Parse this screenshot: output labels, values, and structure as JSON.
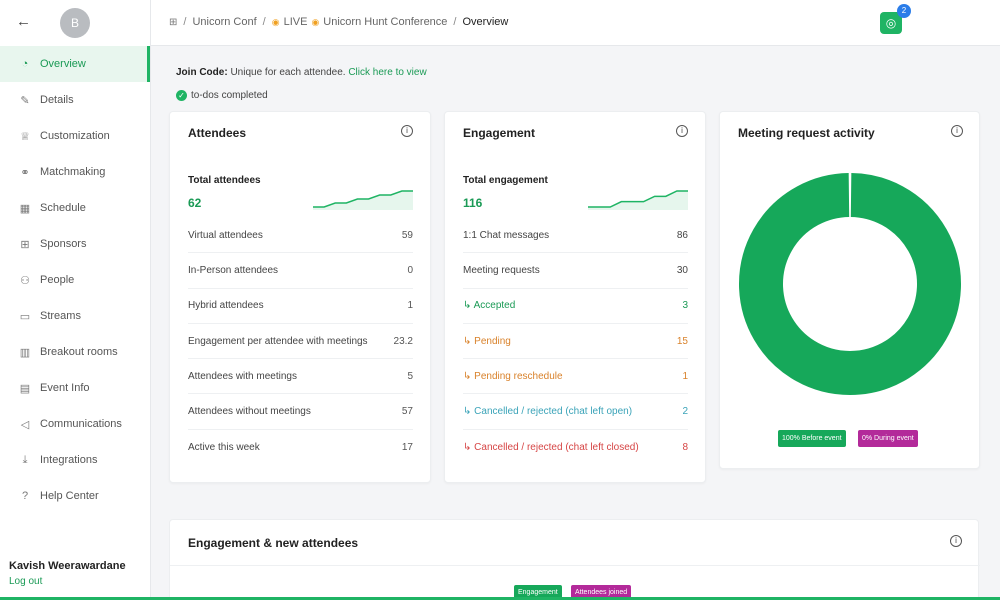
{
  "sidebar": {
    "avatar_letter": "B",
    "items": [
      {
        "label": "Overview",
        "icon": "overview-icon",
        "active": true
      },
      {
        "label": "Details",
        "icon": "edit-icon"
      },
      {
        "label": "Customization",
        "icon": "brush-icon"
      },
      {
        "label": "Matchmaking",
        "icon": "link-icon"
      },
      {
        "label": "Schedule",
        "icon": "calendar-icon"
      },
      {
        "label": "Sponsors",
        "icon": "grid-icon"
      },
      {
        "label": "People",
        "icon": "people-icon"
      },
      {
        "label": "Streams",
        "icon": "monitor-icon"
      },
      {
        "label": "Breakout rooms",
        "icon": "door-icon"
      },
      {
        "label": "Event Info",
        "icon": "document-icon"
      },
      {
        "label": "Communications",
        "icon": "megaphone-icon"
      },
      {
        "label": "Integrations",
        "icon": "download-icon"
      },
      {
        "label": "Help Center",
        "icon": "help-icon"
      }
    ],
    "user_name": "Kavish Weerawardane",
    "logout_label": "Log out"
  },
  "header": {
    "breadcrumb": [
      "Unicorn Conf",
      "LIVE",
      "Unicorn Hunt Conference",
      "Overview"
    ],
    "notification_count": "2"
  },
  "join": {
    "label": "Join Code:",
    "text": "Unique for each attendee.",
    "link": "Click here to view"
  },
  "todo": "to-dos completed",
  "attendees": {
    "title": "Attendees",
    "total_label": "Total attendees",
    "total_value": "62",
    "sparkline": [
      1,
      1,
      1.5,
      1.5,
      2,
      2,
      2.5,
      2.5,
      3,
      3
    ],
    "rows": [
      {
        "label": "Virtual attendees",
        "value": "59"
      },
      {
        "label": "In-Person attendees",
        "value": "0"
      },
      {
        "label": "Hybrid attendees",
        "value": "1"
      },
      {
        "label": "Engagement per attendee with meetings",
        "value": "23.2"
      },
      {
        "label": "Attendees with meetings",
        "value": "5"
      },
      {
        "label": "Attendees without meetings",
        "value": "57"
      },
      {
        "label": "Active this week",
        "value": "17"
      }
    ]
  },
  "engagement": {
    "title": "Engagement",
    "total_label": "Total engagement",
    "total_value": "116",
    "sparkline": [
      1,
      1,
      1,
      2,
      2,
      2,
      3,
      3,
      4,
      4
    ],
    "rows": [
      {
        "label": "1:1 Chat messages",
        "value": "86",
        "color": "#444444"
      },
      {
        "label": "Meeting requests",
        "value": "30",
        "color": "#444444"
      },
      {
        "label": "↳ Accepted",
        "value": "3",
        "color": "#1a9a55"
      },
      {
        "label": "↳ Pending",
        "value": "15",
        "color": "#d9822b"
      },
      {
        "label": "↳ Pending reschedule",
        "value": "1",
        "color": "#d9822b"
      },
      {
        "label": "↳ Cancelled / rejected (chat left open)",
        "value": "2",
        "color": "#3aa3b8"
      },
      {
        "label": "↳ Cancelled / rejected (chat left closed)",
        "value": "8",
        "color": "#d64545"
      }
    ]
  },
  "meeting_activity": {
    "title": "Meeting request activity",
    "legend": [
      {
        "label": "100% Before event",
        "color": "#16a85a",
        "value": 100
      },
      {
        "label": "0% During event",
        "color": "#b32a9a",
        "value": 0
      }
    ]
  },
  "bottom": {
    "title": "Engagement & new attendees",
    "chips": [
      {
        "label": "Engagement",
        "color": "#16a85a"
      },
      {
        "label": "Attendees joined",
        "color": "#b32a9a"
      }
    ]
  },
  "colors": {
    "accent": "#1fb464",
    "accent_dark": "#1a9a55",
    "magenta": "#b32a9a"
  }
}
